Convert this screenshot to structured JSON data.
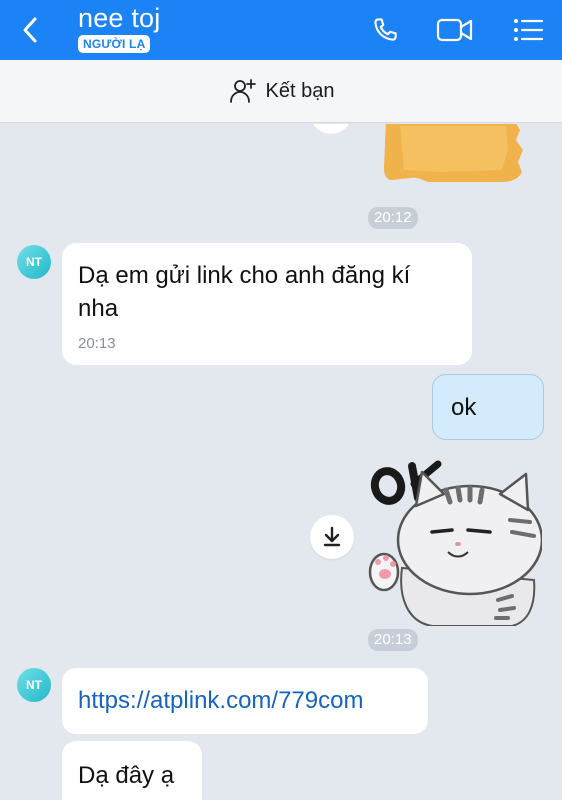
{
  "header": {
    "title": "nee toj",
    "badge": "NGƯỜI LẠ",
    "accent_color": "#1b83f5",
    "icons": [
      "back-icon",
      "phone-icon",
      "video-call-icon",
      "menu-icon"
    ]
  },
  "friend_bar": {
    "label": "Kết bạn",
    "icon": "add-friend-icon"
  },
  "messages": [
    {
      "type": "sticker",
      "direction": "sent",
      "description": "partial sticker (cut off)"
    },
    {
      "type": "timestamp",
      "text": "20:12"
    },
    {
      "type": "text",
      "direction": "received",
      "avatar": "NT",
      "text": "Dạ em gửi link cho anh đăng kí nha",
      "time": "20:13"
    },
    {
      "type": "text",
      "direction": "sent",
      "text": "ok"
    },
    {
      "type": "sticker",
      "direction": "sent",
      "sticker_text": "OK",
      "download_icon": "download-icon"
    },
    {
      "type": "timestamp",
      "text": "20:13"
    },
    {
      "type": "link",
      "direction": "received",
      "avatar": "NT",
      "text": "https://atplink.com/779com"
    },
    {
      "type": "text",
      "direction": "received",
      "text": "Dạ đây ạ"
    }
  ]
}
